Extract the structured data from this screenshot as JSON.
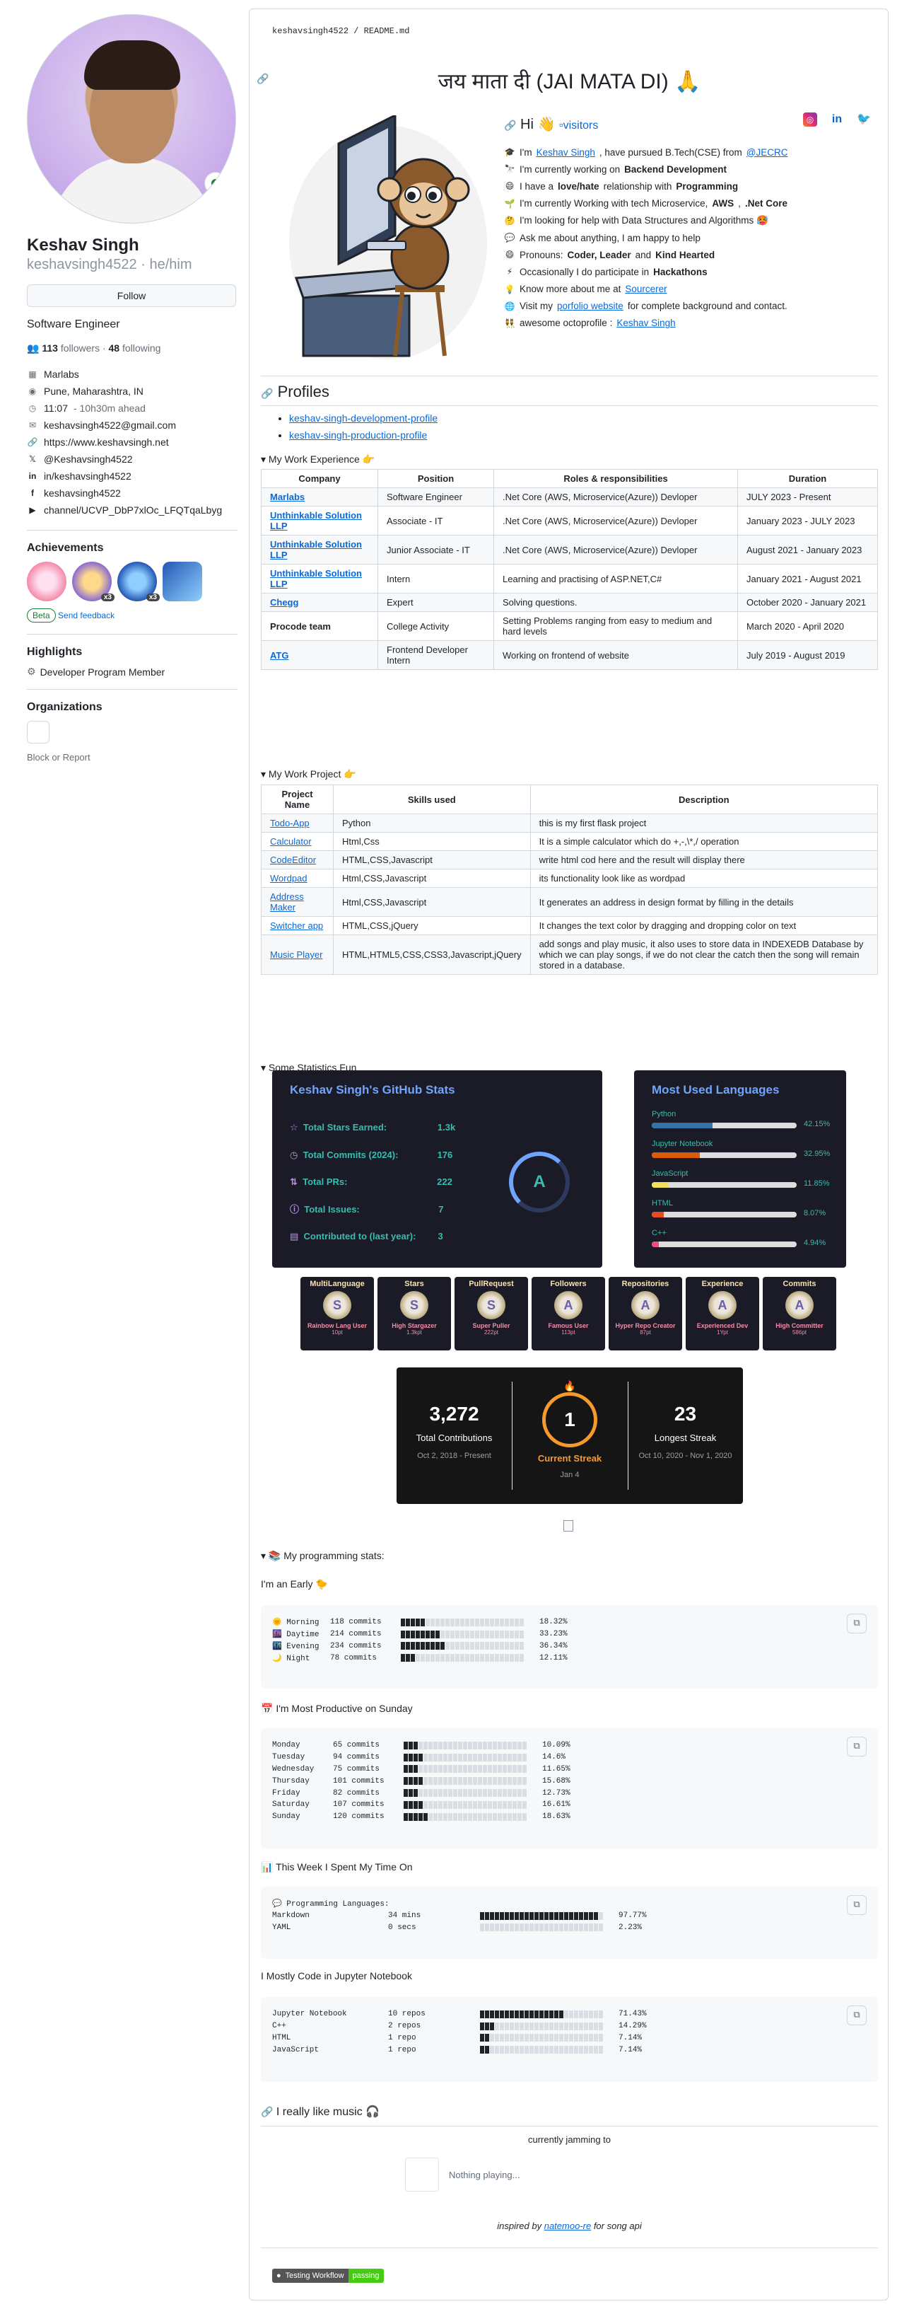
{
  "profile": {
    "name": "Keshav Singh",
    "login": "keshavsingh4522",
    "pronouns": "he/him",
    "follow_label": "Follow",
    "bio": "Software Engineer",
    "followers": "113",
    "followers_label": "followers",
    "following": "48",
    "following_label": "following",
    "details": [
      {
        "icon": "organization-icon",
        "text": "Marlabs"
      },
      {
        "icon": "location-icon",
        "text": "Pune, Maharashtra, IN"
      },
      {
        "icon": "clock-icon",
        "text": "11:07",
        "extra": "- 10h30m ahead"
      },
      {
        "icon": "mail-icon",
        "text": "keshavsingh4522@gmail.com"
      },
      {
        "icon": "link-icon",
        "text": "https://www.keshavsingh.net"
      },
      {
        "icon": "twitter-icon",
        "text": "@Keshavsingh4522"
      },
      {
        "icon": "linkedin-icon",
        "text": "in/keshavsingh4522"
      },
      {
        "icon": "facebook-icon",
        "text": "keshavsingh4522"
      },
      {
        "icon": "youtube-icon",
        "text": "channel/UCVP_DbP7xlOc_LFQTqaLbyg"
      }
    ],
    "achievements_title": "Achievements",
    "achievement_counts": [
      "x3",
      "x3"
    ],
    "beta_label": "Beta",
    "feedback_label": "Send feedback",
    "highlights_title": "Highlights",
    "highlight": "Developer Program Member",
    "orgs_title": "Organizations",
    "block_label": "Block or Report"
  },
  "readme": {
    "breadcrumb": "keshavsingh4522 / README.md",
    "title": "जय माता दी (JAI MATA DI) 🙏",
    "hi": "Hi 👋",
    "visitors_alt": "visitors",
    "intro": [
      {
        "em": "🎓",
        "parts": [
          "I'm ",
          "Keshav Singh",
          ", have pursued B.Tech(CSE) from ",
          "@JECRC"
        ]
      },
      {
        "em": "🔭",
        "parts": [
          "I'm currently working on ",
          "Backend Development"
        ]
      },
      {
        "em": "😄",
        "parts": [
          "I have a ",
          "love/hate",
          " relationship with ",
          "Programming"
        ]
      },
      {
        "em": "🌱",
        "parts": [
          "I'm currently Working with tech Microservice,",
          "AWS",
          ",",
          ".Net Core"
        ]
      },
      {
        "em": "🤔",
        "parts": [
          "I'm looking for help with Data Structures and Algorithms 🥵"
        ]
      },
      {
        "em": "💬",
        "parts": [
          "Ask me about anything, I am happy to help"
        ]
      },
      {
        "em": "😄",
        "parts": [
          "Pronouns: ",
          "Coder, Leader",
          " and ",
          "Kind Hearted"
        ]
      },
      {
        "em": "⚡",
        "parts": [
          "Occasionally I do participate in ",
          "Hackathons"
        ]
      },
      {
        "em": "💡",
        "parts": [
          "Know more about me at ",
          "Sourcerer"
        ]
      },
      {
        "em": "🌐",
        "parts": [
          "Visit my ",
          "porfolio website",
          " for complete background and contact."
        ]
      },
      {
        "em": "👯",
        "parts": [
          "awesome octoprofile : ",
          "Keshav Singh"
        ]
      }
    ],
    "profiles_title": "Profiles",
    "profile_links": [
      "keshav-singh-development-profile",
      "keshav-singh-production-profile"
    ],
    "work_title": "My Work Experience 👉",
    "work_headers": [
      "Company",
      "Position",
      "Roles & responsibilities",
      "Duration"
    ],
    "work": [
      [
        "Marlabs",
        "Software Engineer",
        ".Net Core (AWS, Microservice(Azure)) Devloper",
        "JULY 2023 - Present"
      ],
      [
        "Unthinkable Solution LLP",
        "Associate - IT",
        ".Net Core (AWS, Microservice(Azure)) Devloper",
        "January 2023 - JULY 2023"
      ],
      [
        "Unthinkable Solution LLP",
        "Junior Associate - IT",
        ".Net Core (AWS, Microservice(Azure)) Devloper",
        "August 2021 - January 2023"
      ],
      [
        "Unthinkable Solution LLP",
        "Intern",
        "Learning and practising of ASP.NET,C#",
        "January 2021 - August 2021"
      ],
      [
        "Chegg",
        "Expert",
        "Solving questions.",
        "October 2020 - January 2021"
      ],
      [
        "Procode team",
        "College Activity",
        "Setting Problems ranging from easy to medium and hard levels",
        "March 2020 - April 2020"
      ],
      [
        "ATG",
        "Frontend Developer Intern",
        "Working on frontend of website",
        "July 2019 - August 2019"
      ]
    ],
    "project_title": "My Work Project 👉",
    "project_headers": [
      "Project Name",
      "Skills used",
      "Description"
    ],
    "projects": [
      [
        "Todo-App",
        "Python",
        "this is my first flask project"
      ],
      [
        "Calculator",
        "Html,Css",
        "It is a simple calculator which do +,-,\\*,/ operation"
      ],
      [
        "CodeEditor",
        "HTML,CSS,Javascript",
        "write html cod here and the result will display there"
      ],
      [
        "Wordpad",
        "Html,CSS,Javascript",
        "its functionality look like as wordpad"
      ],
      [
        "Address Maker",
        "Html,CSS,Javascript",
        "It generates an address in design format by filling in the details"
      ],
      [
        "Switcher app",
        "HTML,CSS,jQuery",
        "It changes the text color by dragging and dropping color on text"
      ],
      [
        "Music Player",
        "HTML,HTML5,CSS,CSS3,Javascript,jQuery",
        "add songs and play music, it also uses to store data in INDEXEDB Database by which we can play songs, if we do not clear the catch then the song will remain stored in a database."
      ]
    ],
    "stats_title": "Some Statistics Fun",
    "gh_stats": {
      "title": "Keshav Singh's GitHub Stats",
      "rows": [
        [
          "Total Stars Earned:",
          "1.3k"
        ],
        [
          "Total Commits (2024):",
          "176"
        ],
        [
          "Total PRs:",
          "222"
        ],
        [
          "Total Issues:",
          "7"
        ],
        [
          "Contributed to (last year):",
          "3"
        ]
      ],
      "rank": "A"
    },
    "langs": {
      "title": "Most Used Languages",
      "items": [
        {
          "name": "Python",
          "pct": "42.15%",
          "value": 42.15,
          "color": "#3572A5"
        },
        {
          "name": "Jupyter Notebook",
          "pct": "32.95%",
          "value": 32.95,
          "color": "#DA5B0B"
        },
        {
          "name": "JavaScript",
          "pct": "11.85%",
          "value": 11.85,
          "color": "#f1e05a"
        },
        {
          "name": "HTML",
          "pct": "8.07%",
          "value": 8.07,
          "color": "#e34c26"
        },
        {
          "name": "C++",
          "pct": "4.94%",
          "value": 4.94,
          "color": "#f34b7d"
        }
      ]
    },
    "trophies": [
      {
        "title": "MultiLanguage",
        "rank": "S",
        "name": "Rainbow Lang User",
        "pts": "10pt"
      },
      {
        "title": "Stars",
        "rank": "S",
        "name": "High Stargazer",
        "pts": "1.3kpt"
      },
      {
        "title": "PullRequest",
        "rank": "S",
        "name": "Super Puller",
        "pts": "222pt"
      },
      {
        "title": "Followers",
        "rank": "A",
        "name": "Famous User",
        "pts": "113pt"
      },
      {
        "title": "Repositories",
        "rank": "A",
        "name": "Hyper Repo Creator",
        "pts": "87pt"
      },
      {
        "title": "Experience",
        "rank": "A",
        "name": "Experienced Dev",
        "pts": "1Ypt"
      },
      {
        "title": "Commits",
        "rank": "A",
        "name": "High Committer",
        "pts": "586pt"
      }
    ],
    "streak": {
      "total": "3,272",
      "total_label": "Total Contributions",
      "total_range": "Oct 2, 2018 - Present",
      "current": "1",
      "current_label": "Current Streak",
      "current_range": "Jan 4",
      "longest": "23",
      "longest_label": "Longest Streak",
      "longest_range": "Oct 10, 2020 - Nov 1, 2020"
    },
    "prog_title": "📚 My programming stats:",
    "early_title": "I'm an Early 🐤",
    "early": [
      [
        "🌞 Morning",
        "118 commits",
        5,
        "18.32%"
      ],
      [
        "🌆 Daytime",
        "214 commits",
        8,
        "33.23%"
      ],
      [
        "🌃 Evening",
        "234 commits",
        9,
        "36.34%"
      ],
      [
        "🌙 Night",
        "78 commits",
        3,
        "12.11%"
      ]
    ],
    "sunday_title": "📅 I'm Most Productive on Sunday",
    "sunday": [
      [
        "Monday",
        "65 commits",
        3,
        "10.09%"
      ],
      [
        "Tuesday",
        "94 commits",
        4,
        "14.6%"
      ],
      [
        "Wednesday",
        "75 commits",
        3,
        "11.65%"
      ],
      [
        "Thursday",
        "101 commits",
        4,
        "15.68%"
      ],
      [
        "Friday",
        "82 commits",
        3,
        "12.73%"
      ],
      [
        "Saturday",
        "107 commits",
        4,
        "16.61%"
      ],
      [
        "Sunday",
        "120 commits",
        5,
        "18.63%"
      ]
    ],
    "week_title": "📊 This Week I Spent My Time On",
    "week_sub": "💬 Programming Languages:",
    "week": [
      [
        "Markdown",
        "34 mins",
        24,
        "97.77%"
      ],
      [
        "YAML",
        "0 secs",
        0,
        "2.23%"
      ]
    ],
    "mostly_title": "I Mostly Code in Jupyter Notebook",
    "mostly": [
      [
        "Jupyter Notebook",
        "10 repos",
        17,
        "71.43%"
      ],
      [
        "C++",
        "2 repos",
        3,
        "14.29%"
      ],
      [
        "HTML",
        "1 repo",
        2,
        "7.14%"
      ],
      [
        "JavaScript",
        "1 repo",
        2,
        "7.14%"
      ]
    ],
    "music_title": "I really like music 🎧",
    "jamming": "currently jamming to",
    "nothing": "Nothing playing...",
    "inspired_prefix": "inspired by ",
    "inspired_link": "natemoo-re",
    "inspired_suffix": " for song api",
    "badge_left": "Testing Workflow",
    "badge_right": "passing"
  },
  "colors": {
    "accent": "#0969da",
    "success": "#1a7f37",
    "card_bg": "#1a1b27",
    "stat_title": "#70a5fd",
    "stat_value": "#38bdae",
    "streak_orange": "#f79a2b"
  }
}
